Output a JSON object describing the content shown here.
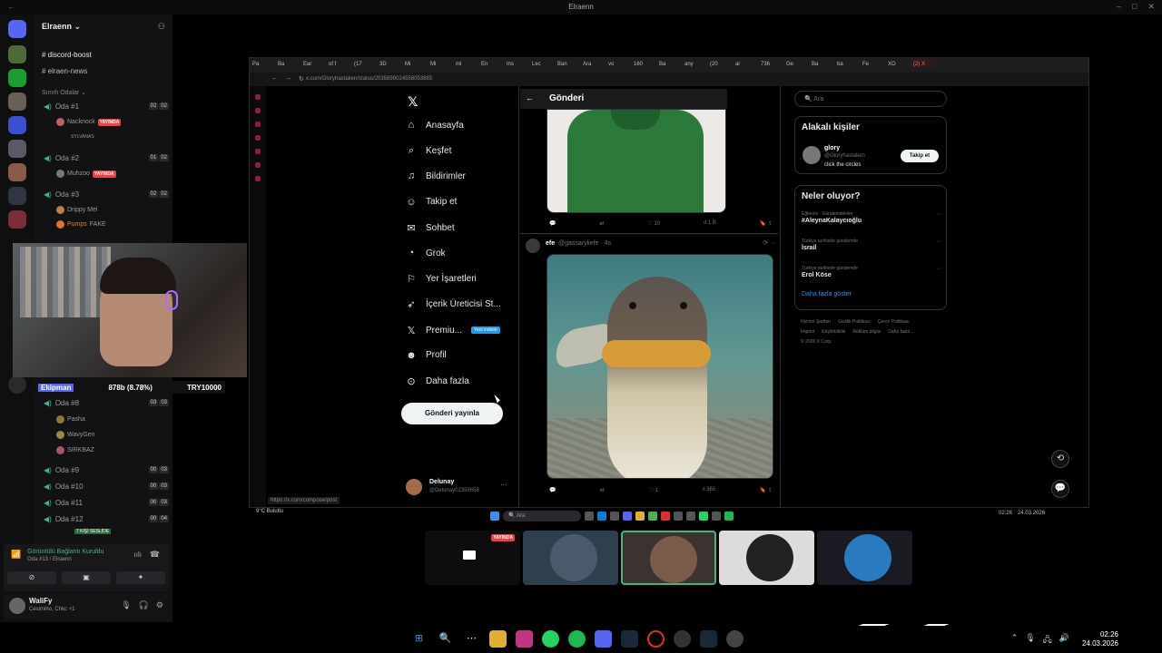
{
  "window": {
    "title": "Elraenn"
  },
  "discord": {
    "server_name": "Elraenn",
    "channels": [
      {
        "label": "discord-boost"
      },
      {
        "label": "elraen-news"
      }
    ],
    "section_label": "Sınırlı Odalar",
    "rooms": [
      {
        "label": "Oda #1",
        "a": "02",
        "b": "02"
      },
      {
        "label": "Oda #2",
        "a": "01",
        "b": "02"
      },
      {
        "label": "Oda #3",
        "a": "02",
        "b": "02"
      },
      {
        "label": "Oda #8",
        "a": "03",
        "b": "03"
      },
      {
        "label": "Oda #9",
        "a": "00",
        "b": "03"
      },
      {
        "label": "Oda #10",
        "a": "00",
        "b": "03"
      },
      {
        "label": "Oda #11",
        "a": "00",
        "b": "03"
      },
      {
        "label": "Oda #12",
        "a": "00",
        "b": "04"
      }
    ],
    "members": {
      "m1": "Nacknock",
      "m2": "SYLVANAS",
      "m3": "Muhzoo",
      "m4": "Drippy Mel",
      "m5": "Pumps",
      "m6": "FAKE",
      "m7": "Pasha",
      "m8": "WavyGen",
      "m9": "SIRKBAZ"
    },
    "live_label": "YAYINDA",
    "voice": {
      "status": "Görüntülü Bağlantı Kuruldu",
      "channel": "Oda #13 / Elraenn",
      "speaking": "7 KİŞİ SESLİDE"
    },
    "user": {
      "name": "WaliFy",
      "status": "Cesimiho, Chkc +1"
    }
  },
  "ticker": {
    "name": "Ekipman",
    "value": "878b (8.78%)",
    "currency": "TRY10000"
  },
  "browser": {
    "url": "x.com/Gloryhastaken/status/2035899024558053885",
    "tabs": [
      "Pa",
      "Ba",
      "Ear",
      "of f",
      "(17",
      "3D",
      "Mi",
      "Mi",
      "mi",
      "En",
      "Ins",
      "Lec",
      "Ban",
      "Ara",
      "vo",
      "160",
      "Ba",
      "any",
      "(20",
      "al",
      "736",
      "Ge",
      "Ba",
      "ba",
      "Fe",
      "XO",
      "(2) X"
    ],
    "hover_url": "https://x.com/compose/post"
  },
  "x": {
    "nav": [
      {
        "label": "Anasayfa",
        "icon": "home-icon"
      },
      {
        "label": "Keşfet",
        "icon": "search-icon"
      },
      {
        "label": "Bildirimler",
        "icon": "bell-icon"
      },
      {
        "label": "Takip et",
        "icon": "follow-icon"
      },
      {
        "label": "Sohbet",
        "icon": "chat-icon"
      },
      {
        "label": "Grok",
        "icon": "grok-icon"
      },
      {
        "label": "Yer İşaretleri",
        "icon": "bookmark-icon"
      },
      {
        "label": "İçerik Üreticisi St...",
        "icon": "rocket-icon"
      },
      {
        "label": "Premiu...",
        "icon": "x-icon"
      },
      {
        "label": "Profil",
        "icon": "person-icon"
      },
      {
        "label": "Daha fazla",
        "icon": "more-icon"
      }
    ],
    "premium_badge": "Yeni indirim",
    "post_button": "Gönderi yayınla",
    "account": {
      "name": "Delunay",
      "handle": "@Delunay02398658"
    },
    "header_title": "Gönderi",
    "tweet1_actions": {
      "likes": "10",
      "views": "1 B"
    },
    "tweet2": {
      "name": "efe",
      "handle": "@gassaryliefe · 4s"
    },
    "tweet2_actions": {
      "likes": "1",
      "views": "365"
    },
    "search_placeholder": "Ara",
    "who": {
      "title": "Alakalı kişiler",
      "name": "glory",
      "handle": "@Gloryhastaken",
      "bio": "click the circles",
      "follow": "Takip et"
    },
    "trends": {
      "title": "Neler oluyor?",
      "items": [
        {
          "category": "Eğlence · Gündemdekiler",
          "topic": "#AleynaKalaycıoğlu"
        },
        {
          "category": "Türkiye tarihinde gündemde",
          "topic": "İsrail"
        },
        {
          "category": "Türkiye tarihinde gündemde",
          "topic": "Erol Köse"
        }
      ],
      "more": "Daha fazla göster"
    },
    "footer": [
      "Hizmet Şartları",
      "Gizlilik Politikası",
      "Çerez Politikası",
      "İmprint",
      "Erişilebilirlik",
      "Reklam bilgisi",
      "Daha fazla ...",
      "© 2026 X Corp."
    ]
  },
  "taskbar_inner": {
    "search": "Ara",
    "time": "02:26",
    "date": "24.03.2026",
    "weather": "9°C Bulutlu"
  },
  "taskbar": {
    "time": "02:26",
    "date": "24.03.2026"
  }
}
